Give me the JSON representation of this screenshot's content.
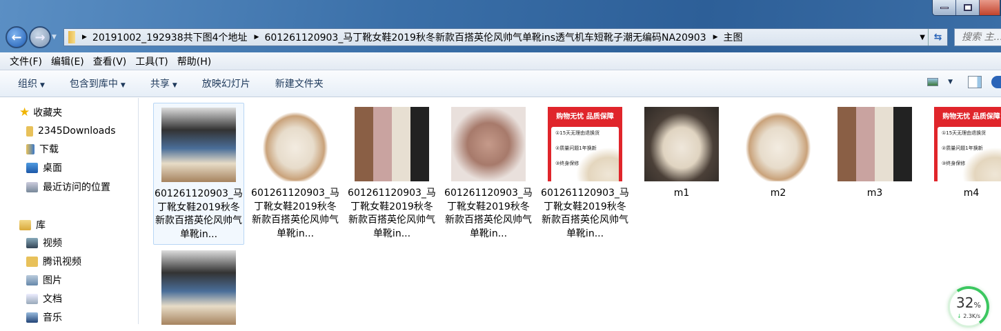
{
  "window": {
    "controls": [
      "minimize",
      "maximize",
      "close"
    ]
  },
  "address": {
    "segments": [
      "20191002_192938共下图4个地址",
      "601261120903_马丁靴女鞋2019秋冬新款百搭英伦风帅气单靴ins透气机车短靴子潮无编码NA20903",
      "主图"
    ]
  },
  "search": {
    "placeholder": "搜索 主..."
  },
  "menu": [
    "文件(F)",
    "编辑(E)",
    "查看(V)",
    "工具(T)",
    "帮助(H)"
  ],
  "toolbar": {
    "organize": "组织",
    "include": "包含到库中",
    "share": "共享",
    "slideshow": "放映幻灯片",
    "new_folder": "新建文件夹"
  },
  "sidebar": {
    "favorites": "收藏夹",
    "downloads2345": "2345Downloads",
    "downloads": "下载",
    "desktop": "桌面",
    "recent": "最近访问的位置",
    "libraries": "库",
    "videos": "视频",
    "tencent_video": "腾讯视频",
    "pictures": "图片",
    "documents": "文档",
    "music": "音乐"
  },
  "ad": {
    "title": "购物无忧  品质保障",
    "l1": "①15天无理由退换货",
    "l2": "②质量问题1年换新",
    "l3": "③终身保修"
  },
  "files": [
    {
      "name": "601261120903_马丁靴女鞋2019秋冬新款百搭英伦风帅气单靴in..."
    },
    {
      "name": "601261120903_马丁靴女鞋2019秋冬新款百搭英伦风帅气单靴in..."
    },
    {
      "name": "601261120903_马丁靴女鞋2019秋冬新款百搭英伦风帅气单靴in..."
    },
    {
      "name": "601261120903_马丁靴女鞋2019秋冬新款百搭英伦风帅气单靴in..."
    },
    {
      "name": "601261120903_马丁靴女鞋2019秋冬新款百搭英伦风帅气单靴in..."
    },
    {
      "name": "m1"
    },
    {
      "name": "m2"
    },
    {
      "name": "m3"
    },
    {
      "name": "m4"
    },
    {
      "name": ""
    }
  ],
  "speed_widget": {
    "percent": "32",
    "unit": "%",
    "speed": "2.3K/s"
  }
}
